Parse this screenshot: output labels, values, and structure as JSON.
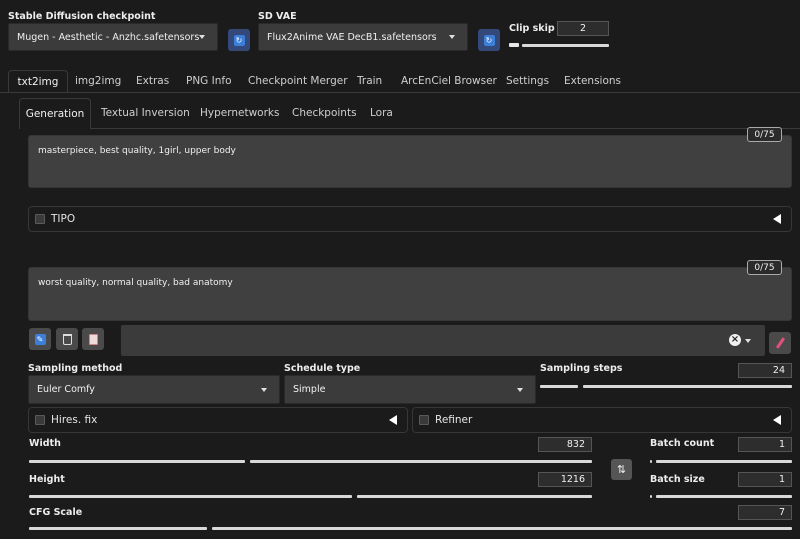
{
  "header": {
    "checkpoint_label": "Stable Diffusion checkpoint",
    "checkpoint_value": "Mugen - Aesthetic - Anzhc.safetensors",
    "vae_label": "SD VAE",
    "vae_value": "Flux2Anime VAE DecB1.safetensors",
    "clip_skip_label": "Clip skip",
    "clip_skip_value": "2",
    "clip_skip_fraction": 0.2
  },
  "top_tabs": [
    "txt2img",
    "img2img",
    "Extras",
    "PNG Info",
    "Checkpoint Merger",
    "Train",
    "ArcEnCiel Browser",
    "Settings",
    "Extensions"
  ],
  "sub_tabs": [
    "Generation",
    "Textual Inversion",
    "Hypernetworks",
    "Checkpoints",
    "Lora"
  ],
  "prompt": {
    "positive": "masterpiece, best quality, 1girl, upper body",
    "positive_count": "0/75",
    "negative": "worst quality, normal quality, bad anatomy",
    "negative_count": "0/75"
  },
  "tipo_label": "TIPO",
  "styles": {
    "clear_symbol": "×"
  },
  "sampling": {
    "method_label": "Sampling method",
    "method_value": "Euler Comfy",
    "schedule_label": "Schedule type",
    "schedule_value": "Simple",
    "steps_label": "Sampling steps",
    "steps_value": "24"
  },
  "hires_label": "Hires. fix",
  "refiner_label": "Refiner",
  "dimensions": {
    "width_label": "Width",
    "width_value": "832",
    "height_label": "Height",
    "height_value": "1216",
    "swap_symbol": "⇅"
  },
  "batch": {
    "count_label": "Batch count",
    "count_value": "1",
    "size_label": "Batch size",
    "size_value": "1"
  },
  "cfg": {
    "label": "CFG Scale",
    "value": "7"
  },
  "colors": {
    "refresh_button": "#3c7fd8",
    "accent_pink": "#e0507a"
  }
}
